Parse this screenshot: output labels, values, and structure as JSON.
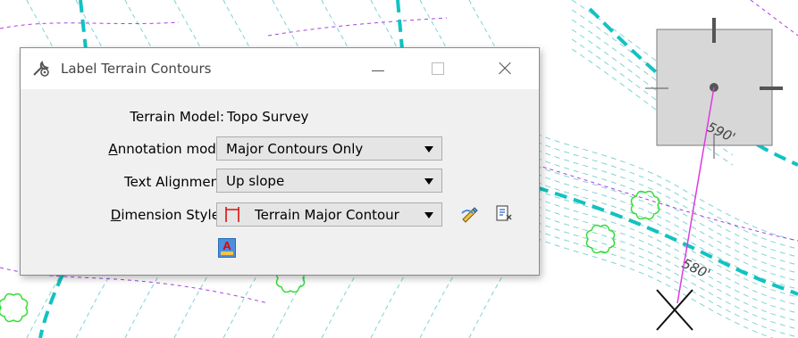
{
  "canvas": {
    "contour_labels": [
      "590'",
      "580'"
    ],
    "colors": {
      "major_contour": "#12c2c2",
      "minor_contour": "#7fd3d3",
      "secondary_line": "#a641e0",
      "tree_outline": "#33dd33",
      "label_line": "#e03ae0",
      "nav_panel": "#d7d7d7"
    }
  },
  "dialog": {
    "title": "Label Terrain Contours",
    "title_icon": "settings-wrench-icon",
    "terrain_model_label": "Terrain Model:",
    "terrain_model_value": "Topo Survey",
    "annotation_mode_label_pre": "",
    "annotation_mode_label_u": "A",
    "annotation_mode_label_post": "nnotation mode",
    "annotation_mode_value": "Major Contours Only",
    "text_alignment_label_pre": "Text Ali",
    "text_alignment_label_u": "g",
    "text_alignment_label_post": "nment",
    "text_alignment_value": "Up slope",
    "dimension_style_label_pre": "",
    "dimension_style_label_u": "D",
    "dimension_style_label_post": "imension Style:",
    "dimension_style_value": "Terrain Major Contour",
    "dimension_style_icon": "dimension-bracket-icon",
    "edit_style_icon": "pencil-edit-icon",
    "text_style_button_letter": "A"
  }
}
